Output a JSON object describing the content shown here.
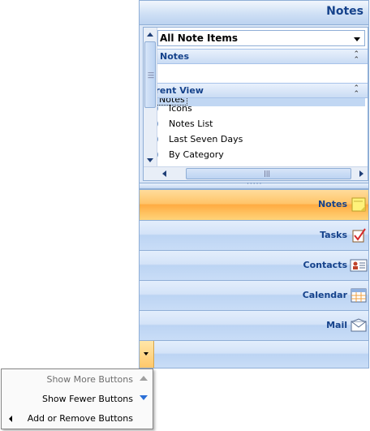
{
  "nav_pane": {
    "title": "Notes",
    "folder_selector": {
      "value": "All Note Items"
    },
    "sections": [
      {
        "label": "y Notes",
        "chevron": "collapse-up"
      },
      {
        "label": "rrent View",
        "chevron": "collapse-up"
      }
    ],
    "folders": [
      {
        "label": "Notes",
        "selected": true
      }
    ],
    "views": [
      {
        "label": "Icons",
        "selected": true
      },
      {
        "label": "Notes List",
        "selected": false
      },
      {
        "label": "Last Seven Days",
        "selected": false
      },
      {
        "label": "By Category",
        "selected": false
      }
    ],
    "splitter_grip": "·····",
    "buttons": [
      {
        "label": "Notes",
        "icon": "note-icon",
        "active": true
      },
      {
        "label": "Tasks",
        "icon": "task-check-icon",
        "active": false
      },
      {
        "label": "Contacts",
        "icon": "contact-card-icon",
        "active": false
      },
      {
        "label": "Calendar",
        "icon": "calendar-icon",
        "active": false
      },
      {
        "label": "Mail",
        "icon": "mail-envelope-icon",
        "active": false
      }
    ]
  },
  "context_menu": {
    "items": [
      {
        "label": "Show More Buttons",
        "enabled": false,
        "icon": "arrow-up-icon"
      },
      {
        "label": "Show Fewer Buttons",
        "enabled": true,
        "icon": "arrow-down-icon"
      },
      {
        "label": "Add or Remove Buttons",
        "enabled": true,
        "icon": "submenu-arrow-icon"
      }
    ]
  },
  "colors": {
    "title_text": "#15428b",
    "active_button": "#ffc56a",
    "border": "#8faed6"
  }
}
